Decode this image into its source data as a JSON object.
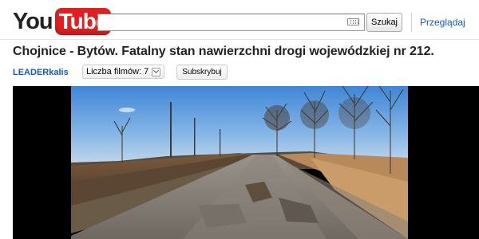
{
  "header": {
    "logo": {
      "you": "You",
      "tube": "Tube"
    },
    "search": {
      "value": "",
      "button_label": "Szukaj"
    },
    "browse_label": "Przeglądaj"
  },
  "video": {
    "title": "Chojnice - Bytów. Fatalny stan nawierzchni drogi wojewódzkiej nr 212.",
    "channel": "LEADERkalis",
    "count_label": "Liczba filmów:",
    "count_value": "7",
    "subscribe_label": "Subskrybuj"
  },
  "colors": {
    "logo_red": "#e02020",
    "link_blue": "#1a56c2"
  },
  "icons": [
    "keyboard-icon",
    "chevron-down-icon"
  ]
}
